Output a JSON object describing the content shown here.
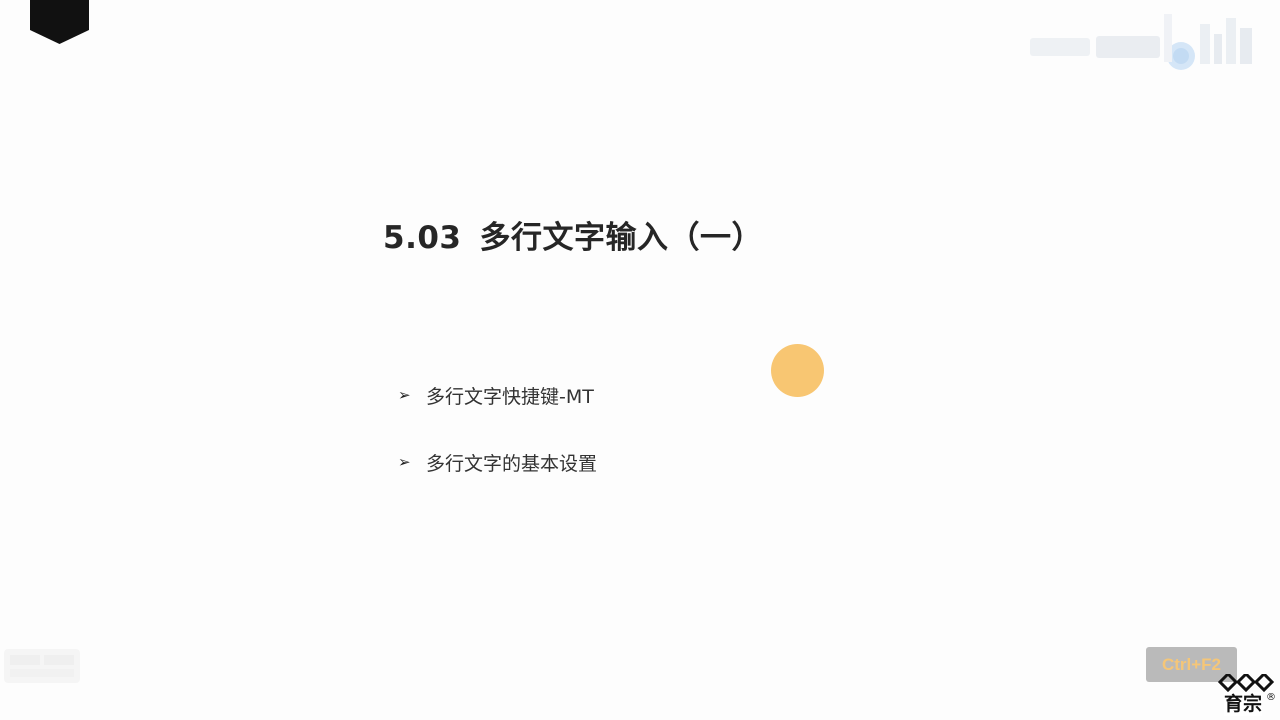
{
  "slide": {
    "title_number": "5.03",
    "title_text": "多行文字输入（一）",
    "bullets": [
      {
        "label": "多行文字快捷键-MT"
      },
      {
        "label": "多行文字的基本设置"
      }
    ],
    "bullet_glyph": "➢"
  },
  "overlay": {
    "key_badge": "Ctrl+F2",
    "brand_name": "育宗",
    "brand_mark": "®"
  },
  "colors": {
    "accent_dot": "#f8c672",
    "title": "#262626",
    "corner_tab": "#111111"
  }
}
